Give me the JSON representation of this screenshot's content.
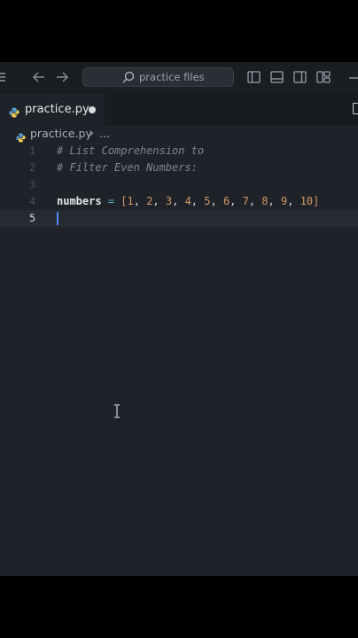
{
  "search": {
    "text": "practice files"
  },
  "tab": {
    "label": "practice.py"
  },
  "breadcrumb": {
    "file": "practice.py",
    "separator": "›",
    "more": "..."
  },
  "editor": {
    "line_numbers": [
      "1",
      "2",
      "3",
      "4",
      "5"
    ],
    "comment1": "# List Comprehension to",
    "comment2": "# Filter Even Numbers:",
    "var": "numbers",
    "eq": " = ",
    "lbracket": "[",
    "n1": "1",
    "n2": "2",
    "n3": "3",
    "n4": "4",
    "n5": "5",
    "n6": "6",
    "n7": "7",
    "n8": "8",
    "n9": "9",
    "n10": "10",
    "comma": ", ",
    "rbracket": "]"
  },
  "colors": {
    "background": "#1f2329",
    "comment": "#7f848e",
    "number": "#d19a66",
    "operator": "#56b6c2",
    "cursor": "#528bff"
  },
  "icons": [
    "menu-icon",
    "back-arrow-icon",
    "forward-arrow-icon",
    "search-icon",
    "toggle-sidebar-icon",
    "toggle-panel-icon",
    "toggle-secondary-sidebar-icon",
    "customize-layout-icon",
    "minimize-icon",
    "python-file-icon",
    "unsaved-dot-icon",
    "text-cursor-icon"
  ]
}
